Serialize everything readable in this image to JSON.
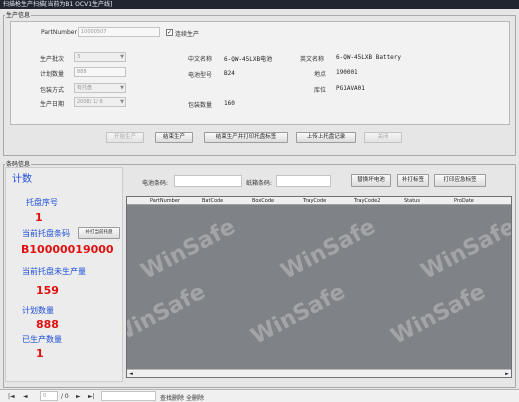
{
  "window": {
    "title": "扫描枪生产扫描[当前为B1 OCV1生产线]"
  },
  "production_info": {
    "group_title": "生产信息",
    "part_number_label": "PartNumber",
    "part_number_value": "10000507",
    "continuous_label": "连续生产",
    "continuous_checked": "✓",
    "batch_label": "生产批次",
    "batch_value": "3",
    "plan_qty_label": "计划数量",
    "plan_qty_value": "888",
    "pack_method_label": "包装方式",
    "pack_method_value": "有托盘",
    "prod_date_label": "生产日期",
    "prod_date_value": "2008/ 1/ 8",
    "cn_name_label": "中文名称",
    "cn_name_value": "6-QW-45LXB电池",
    "en_name_label": "英文名称",
    "en_name_value": "6-QW-45LXB Battery",
    "battery_model_label": "电池型号",
    "battery_model_value": "B24",
    "location_label": "地点",
    "location_value": "190001",
    "storage_label": "库位",
    "storage_value": "PG1AVA01",
    "pack_qty_label": "包装数量",
    "pack_qty_value": "160"
  },
  "actions": {
    "start_production": "开始生产",
    "end_production": "结束生产",
    "end_and_print": "结束生产并打印托盘标签",
    "upload_tray": "上传上托盘记录",
    "close": "关闭"
  },
  "barcode_info": {
    "group_title": "条码信息",
    "count_title": "计数",
    "battery_barcode_label": "电池条码:",
    "carton_barcode_label": "纸箱条码:",
    "btn_replace_battery": "替换坏电池",
    "btn_reprint_label": "补打标签",
    "btn_print_emergency": "打印应急标签"
  },
  "counter": {
    "tray_seq_label": "托盘序号",
    "tray_seq_value": "1",
    "current_tray_barcode_label": "当前托盘条码",
    "reprint_tray_button": "补打当前托盘",
    "current_tray_barcode_value": "B10000019000",
    "unproduced_label": "当前托盘未生产量",
    "unproduced_value": "159",
    "plan_qty_label": "计划数量",
    "plan_qty_value": "888",
    "produced_label": "已生产数量",
    "produced_value": "1"
  },
  "grid": {
    "columns": [
      "PartNumber",
      "BatCode",
      "BoxCode",
      "TrayCode",
      "TrayCode2",
      "Status",
      "ProDate"
    ],
    "watermark": "WinSafe"
  },
  "pager": {
    "first": "|◄",
    "prev": "◄",
    "page_value": "0",
    "of_text": "/ 0",
    "next": "►",
    "last": "►|",
    "query_delete": "查找删除",
    "delete_all": "全删除"
  }
}
